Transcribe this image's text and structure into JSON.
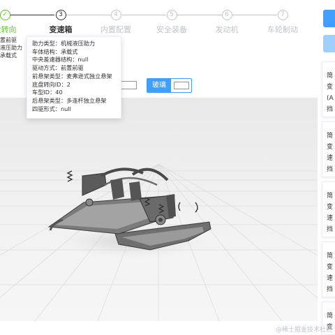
{
  "steps": [
    {
      "num": "",
      "label": "盘转向",
      "state": "done"
    },
    {
      "num": "3",
      "label": "变速箱",
      "state": "active"
    },
    {
      "num": "4",
      "label": "内置配置",
      "state": "todo"
    },
    {
      "num": "5",
      "label": "安全装备",
      "state": "todo"
    },
    {
      "num": "6",
      "label": "发动机",
      "state": "todo"
    },
    {
      "num": "7",
      "label": "车轮制动",
      "state": "todo"
    }
  ],
  "left_list": [
    "置前驱",
    "液压助力",
    "承载式"
  ],
  "toolbar": {
    "glass_label": "玻璃"
  },
  "tooltip": [
    "助力类型：机械液压助力",
    "车体结构：承载式",
    "中央差速器结构：null",
    "驱动方式：前置前驱",
    "前悬架类型：麦弗逊式独立悬架",
    "底盘转向ID：2",
    "车型ID：40",
    "后悬架类型：多连杆独立悬架",
    "四驱形式：null"
  ],
  "cards": [
    [
      "简",
      "变",
      "(A",
      "挡"
    ],
    [
      "简",
      "变",
      "速",
      "挡"
    ],
    [
      "简",
      "变",
      "速",
      "挡"
    ],
    [
      "简",
      "变",
      "速",
      "挡"
    ],
    [
      "简",
      "变"
    ]
  ],
  "watermark": "@稀土掘金技术社区",
  "colors": {
    "primary": "#409eff",
    "primary_light": "#a0cfff",
    "success": "#67c23a",
    "muted": "#c0c4cc"
  }
}
